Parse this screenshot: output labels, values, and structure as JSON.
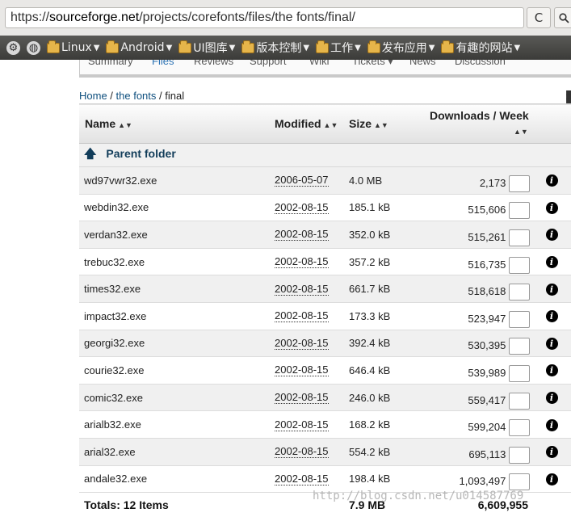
{
  "browser": {
    "url_prefix": "https://",
    "url_host": "sourceforge.net",
    "url_path": "/projects/corefonts/files/the fonts/final/",
    "reload_glyph": "C",
    "search_icon": "search-icon"
  },
  "bookmarks": {
    "items": [
      {
        "label": "Linux"
      },
      {
        "label": "Android"
      },
      {
        "label": "UI图库"
      },
      {
        "label": "版本控制"
      },
      {
        "label": "工作"
      },
      {
        "label": "发布应用"
      },
      {
        "label": "有趣的网站"
      }
    ]
  },
  "tabs": [
    {
      "label": "Summary"
    },
    {
      "label": "Files"
    },
    {
      "label": "Reviews"
    },
    {
      "label": "Support"
    },
    {
      "label": "Wiki"
    },
    {
      "label": "Tickets ▾"
    },
    {
      "label": "News"
    },
    {
      "label": "Discussion"
    }
  ],
  "breadcrumb": {
    "home": "Home",
    "sep": " / ",
    "fonts": "the fonts",
    "current": "final"
  },
  "table": {
    "headers": {
      "name": "Name",
      "modified": "Modified",
      "size": "Size",
      "downloads": "Downloads / Week"
    },
    "parent_label": "Parent folder",
    "rows": [
      {
        "name": "wd97vwr32.exe",
        "modified": "2006-05-07",
        "size": "4.0 MB",
        "downloads": "2,173"
      },
      {
        "name": "webdin32.exe",
        "modified": "2002-08-15",
        "size": "185.1 kB",
        "downloads": "515,606"
      },
      {
        "name": "verdan32.exe",
        "modified": "2002-08-15",
        "size": "352.0 kB",
        "downloads": "515,261"
      },
      {
        "name": "trebuc32.exe",
        "modified": "2002-08-15",
        "size": "357.2 kB",
        "downloads": "516,735"
      },
      {
        "name": "times32.exe",
        "modified": "2002-08-15",
        "size": "661.7 kB",
        "downloads": "518,618"
      },
      {
        "name": "impact32.exe",
        "modified": "2002-08-15",
        "size": "173.3 kB",
        "downloads": "523,947"
      },
      {
        "name": "georgi32.exe",
        "modified": "2002-08-15",
        "size": "392.4 kB",
        "downloads": "530,395"
      },
      {
        "name": "courie32.exe",
        "modified": "2002-08-15",
        "size": "646.4 kB",
        "downloads": "539,989"
      },
      {
        "name": "comic32.exe",
        "modified": "2002-08-15",
        "size": "246.0 kB",
        "downloads": "559,417"
      },
      {
        "name": "arialb32.exe",
        "modified": "2002-08-15",
        "size": "168.2 kB",
        "downloads": "599,204"
      },
      {
        "name": "arial32.exe",
        "modified": "2002-08-15",
        "size": "554.2 kB",
        "downloads": "695,113"
      },
      {
        "name": "andale32.exe",
        "modified": "2002-08-15",
        "size": "198.4 kB",
        "downloads": "1,093,497"
      }
    ],
    "totals": {
      "label": "Totals: 12 Items",
      "size": "7.9 MB",
      "downloads": "6,609,955"
    }
  },
  "watermark": "http://blog.csdn.net/u014587769"
}
